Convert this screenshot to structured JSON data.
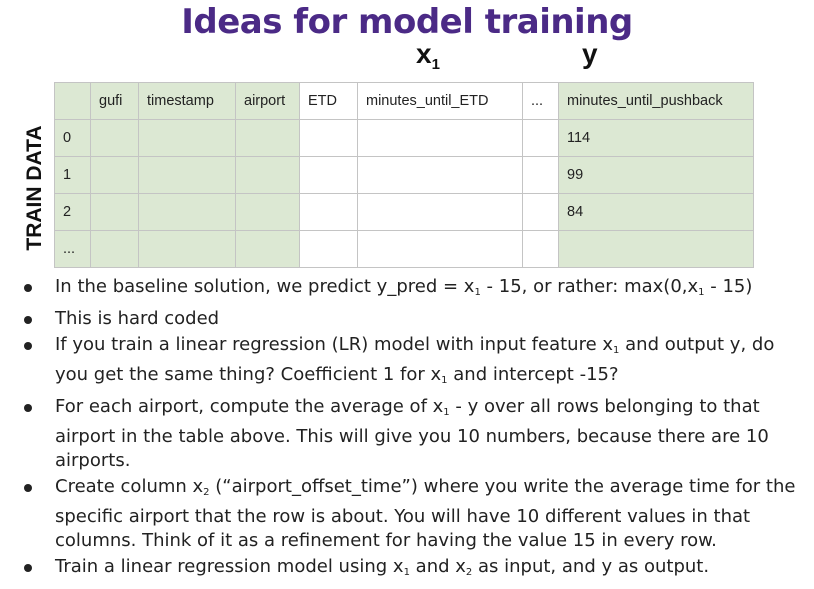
{
  "title": "Ideas for model training",
  "labels": {
    "x_main": "x",
    "x_sub": "1",
    "y": "y",
    "side": "TRAIN DATA"
  },
  "table": {
    "headers": [
      "",
      "gufi",
      "timestamp",
      "airport",
      "ETD",
      "minutes_until_ETD",
      "...",
      "minutes_until_pushback"
    ],
    "rows": [
      [
        "0",
        "",
        "",
        "",
        "",
        "",
        "",
        "114"
      ],
      [
        "1",
        "",
        "",
        "",
        "",
        "",
        "",
        "99"
      ],
      [
        "2",
        "",
        "",
        "",
        "",
        "",
        "",
        "84"
      ],
      [
        "...",
        "",
        "",
        "",
        "",
        "",
        "",
        ""
      ]
    ],
    "fill_pattern": [
      "green",
      "green",
      "green",
      "green",
      "white",
      "white",
      "white",
      "green"
    ],
    "colors": {
      "green": "#dce8d3",
      "white": "#ffffff",
      "border": "#c4c4c4",
      "title": "#4b2a86"
    }
  },
  "bullets": [
    {
      "parts": [
        {
          "t": "In the baseline solution, we predict y_pred = x"
        },
        {
          "sub": "1"
        },
        {
          "t": " - 15, or rather:  max(0,x"
        },
        {
          "sub": "1"
        },
        {
          "t": " - 15)"
        }
      ]
    },
    {
      "parts": [
        {
          "t": "This is hard coded"
        }
      ]
    },
    {
      "parts": [
        {
          "t": "If you train a linear regression (LR) model with input feature x"
        },
        {
          "sub": "1"
        },
        {
          "t": " and output y, do you get the same thing? Coefficient 1 for x"
        },
        {
          "sub": "1"
        },
        {
          "t": " and intercept -15?"
        }
      ]
    },
    {
      "parts": [
        {
          "t": "For each airport, compute the average of x"
        },
        {
          "sub": "1"
        },
        {
          "t": " - y over all rows belonging to that airport in the table above. This will give you 10 numbers, because there are 10 airports."
        }
      ]
    },
    {
      "parts": [
        {
          "t": "Create column x"
        },
        {
          "sub": "2"
        },
        {
          "t": " (“airport_offset_time”) where you write the average time for the specific airport that the row is about. You will have 10 different values in that columns. Think of it as a refinement for having the value 15 in every row."
        }
      ]
    },
    {
      "parts": [
        {
          "t": "Train a linear regression model using x"
        },
        {
          "sub": "1"
        },
        {
          "t": " and x"
        },
        {
          "sub": "2"
        },
        {
          "t": " as input, and y as output."
        }
      ]
    }
  ]
}
